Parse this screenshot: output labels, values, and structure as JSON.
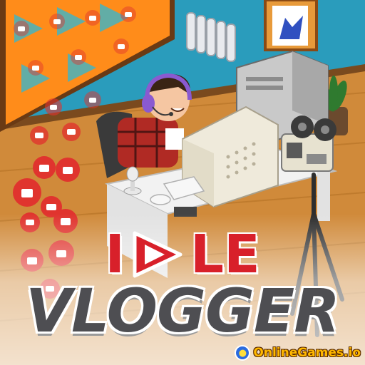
{
  "title": {
    "line1_left": "I",
    "line1_right": "LE",
    "line1_icon": "play-icon",
    "line2": "VLOGGER"
  },
  "brand": {
    "logo_icon": "gamepad-globe-icon",
    "text": "OnlineGames.io"
  },
  "colors": {
    "title_red": "#d8202a",
    "title_gray": "#4e4e52",
    "like_bubble": "#e0342e",
    "floor": "#d08a3a",
    "wall": "#1f8fb0",
    "brand_text": "#ffb800"
  }
}
